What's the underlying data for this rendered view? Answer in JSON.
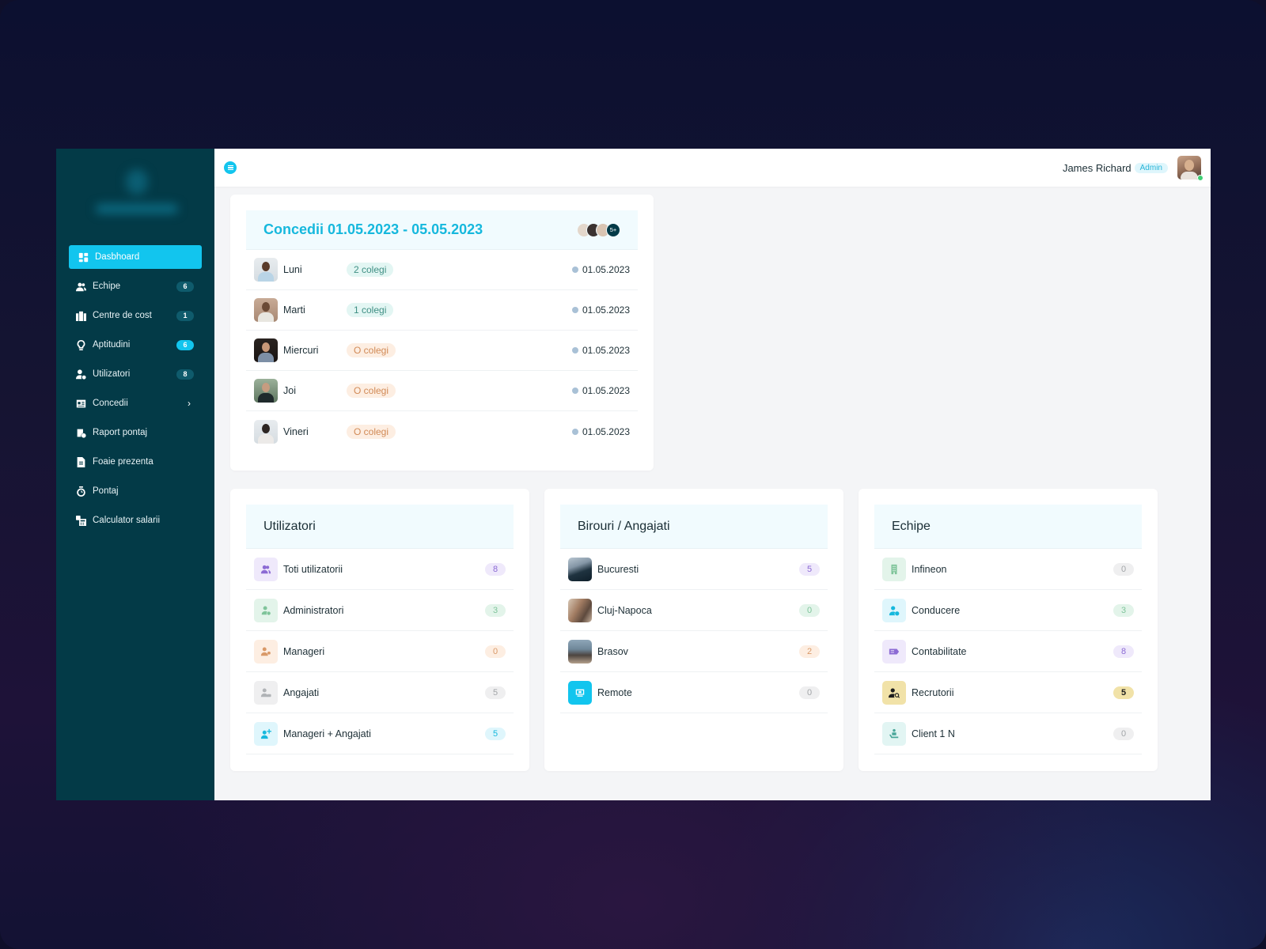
{
  "sidebar": {
    "logo_text": "Company logo (blurred)",
    "items": [
      {
        "label": "Dasbhoard",
        "icon": "dashboard-icon",
        "active": true
      },
      {
        "label": "Echipe",
        "icon": "users-icon",
        "badge": "6"
      },
      {
        "label": "Centre de cost",
        "icon": "buildings-icon",
        "badge": "1"
      },
      {
        "label": "Aptitudini",
        "icon": "lightbulb-icon",
        "badge": "6",
        "badge_highlight": true
      },
      {
        "label": "Utilizatori",
        "icon": "user-cog-icon",
        "badge": "8"
      },
      {
        "label": "Concedii",
        "icon": "id-card-icon",
        "has_submenu": true
      },
      {
        "label": "Raport pontaj",
        "icon": "report-clock-icon"
      },
      {
        "label": "Foaie prezenta",
        "icon": "document-icon"
      },
      {
        "label": "Pontaj",
        "icon": "stopwatch-icon"
      },
      {
        "label": "Calculator salarii",
        "icon": "calculator-icon"
      }
    ]
  },
  "topbar": {
    "menu_icon": "menu-icon",
    "user_name": "James Richard",
    "user_role": "Admin",
    "status": "online"
  },
  "leave_card": {
    "title": "Concedii 01.05.2023 - 05.05.2023",
    "avatars_more": "5+",
    "rows": [
      {
        "day": "Luni",
        "colleagues": "2 colegi",
        "tone": "teal",
        "date": "01.05.2023"
      },
      {
        "day": "Marti",
        "colleagues": "1 colegi",
        "tone": "teal",
        "date": "01.05.2023"
      },
      {
        "day": "Miercuri",
        "colleagues": "O colegi",
        "tone": "orange",
        "date": "01.05.2023"
      },
      {
        "day": "Joi",
        "colleagues": "O colegi",
        "tone": "orange",
        "date": "01.05.2023"
      },
      {
        "day": "Vineri",
        "colleagues": "O colegi",
        "tone": "orange",
        "date": "01.05.2023"
      }
    ]
  },
  "users_card": {
    "title": "Utilizatori",
    "rows": [
      {
        "label": "Toti utilizatorii",
        "count": "8",
        "icon": "users-icon"
      },
      {
        "label": "Administratori",
        "count": "3",
        "icon": "user-cog-icon"
      },
      {
        "label": "Manageri",
        "count": "0",
        "icon": "user-gear-icon"
      },
      {
        "label": "Angajati",
        "count": "5",
        "icon": "user-id-icon"
      },
      {
        "label": "Manageri + Angajati",
        "count": "5",
        "icon": "user-plus-icon"
      }
    ]
  },
  "offices_card": {
    "title": "Birouri / Angajati",
    "rows": [
      {
        "label": "Bucuresti",
        "count": "5",
        "icon": "city-photo"
      },
      {
        "label": "Cluj-Napoca",
        "count": "0",
        "icon": "city-photo"
      },
      {
        "label": "Brasov",
        "count": "2",
        "icon": "city-photo"
      },
      {
        "label": "Remote",
        "count": "0",
        "icon": "remote-desk-icon"
      }
    ]
  },
  "teams_card": {
    "title": "Echipe",
    "rows": [
      {
        "label": "Infineon",
        "count": "0",
        "icon": "building-icon"
      },
      {
        "label": "Conducere",
        "count": "3",
        "icon": "user-check-icon"
      },
      {
        "label": "Contabilitate",
        "count": "8",
        "icon": "money-tag-icon"
      },
      {
        "label": "Recrutorii",
        "count": "5",
        "icon": "user-search-icon"
      },
      {
        "label": "Client 1 N",
        "count": "0",
        "icon": "client-service-icon"
      }
    ]
  },
  "colors": {
    "sidebar_bg": "#033a47",
    "accent": "#12c5ee",
    "title_accent": "#16b8dd",
    "page_bg": "#f4f5f7"
  }
}
